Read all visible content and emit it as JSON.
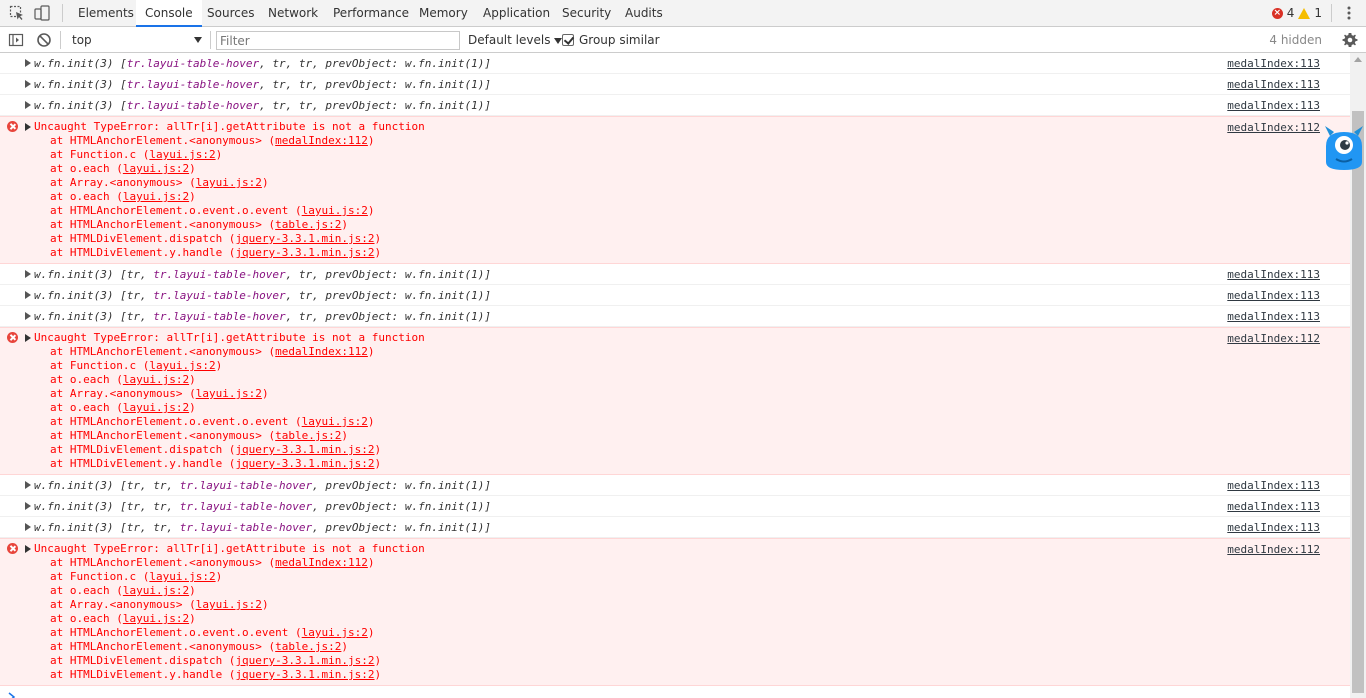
{
  "tabs": [
    {
      "label": "Elements"
    },
    {
      "label": "Console",
      "active": true
    },
    {
      "label": "Sources"
    },
    {
      "label": "Network"
    },
    {
      "label": "Performance"
    },
    {
      "label": "Memory"
    },
    {
      "label": "Application"
    },
    {
      "label": "Security"
    },
    {
      "label": "Audits"
    }
  ],
  "counts": {
    "errors": "4",
    "warnings": "1"
  },
  "toolbar": {
    "context": "top",
    "filter_placeholder": "Filter",
    "levels": "Default levels",
    "group_similar": "Group similar",
    "hidden": "4 hidden"
  },
  "colors": {
    "error_text": "#ff0000",
    "error_bg": "#fff0f0",
    "accent": "#1a73e8"
  },
  "log": [
    {
      "type": "obj",
      "parts": [
        "w.fn.init(3) [",
        "tr.layui-table-hover",
        ", tr, tr, prevObject: w.fn.init(1)]"
      ],
      "source": "medalIndex:113"
    },
    {
      "type": "obj",
      "parts": [
        "w.fn.init(3) [",
        "tr.layui-table-hover",
        ", tr, tr, prevObject: w.fn.init(1)]"
      ],
      "source": "medalIndex:113"
    },
    {
      "type": "obj",
      "parts": [
        "w.fn.init(3) [",
        "tr.layui-table-hover",
        ", tr, tr, prevObject: w.fn.init(1)]"
      ],
      "source": "medalIndex:113"
    },
    {
      "type": "err",
      "source": "medalIndex:112",
      "message": "Uncaught TypeError: allTr[i].getAttribute is not a function",
      "frames": [
        [
          "at HTMLAnchorElement.<anonymous> (",
          "medalIndex:112",
          ")"
        ],
        [
          "at Function.c (",
          "layui.js:2",
          ")"
        ],
        [
          "at o.each (",
          "layui.js:2",
          ")"
        ],
        [
          "at Array.<anonymous> (",
          "layui.js:2",
          ")"
        ],
        [
          "at o.each (",
          "layui.js:2",
          ")"
        ],
        [
          "at HTMLAnchorElement.o.event.o.event (",
          "layui.js:2",
          ")"
        ],
        [
          "at HTMLAnchorElement.<anonymous> (",
          "table.js:2",
          ")"
        ],
        [
          "at HTMLDivElement.dispatch (",
          "jquery-3.3.1.min.js:2",
          ")"
        ],
        [
          "at HTMLDivElement.y.handle (",
          "jquery-3.3.1.min.js:2",
          ")"
        ]
      ]
    },
    {
      "type": "obj",
      "parts": [
        "w.fn.init(3) [tr, ",
        "tr.layui-table-hover",
        ", tr, prevObject: w.fn.init(1)]"
      ],
      "source": "medalIndex:113"
    },
    {
      "type": "obj",
      "parts": [
        "w.fn.init(3) [tr, ",
        "tr.layui-table-hover",
        ", tr, prevObject: w.fn.init(1)]"
      ],
      "source": "medalIndex:113"
    },
    {
      "type": "obj",
      "parts": [
        "w.fn.init(3) [tr, ",
        "tr.layui-table-hover",
        ", tr, prevObject: w.fn.init(1)]"
      ],
      "source": "medalIndex:113"
    },
    {
      "type": "err",
      "source": "medalIndex:112",
      "message": "Uncaught TypeError: allTr[i].getAttribute is not a function",
      "frames": [
        [
          "at HTMLAnchorElement.<anonymous> (",
          "medalIndex:112",
          ")"
        ],
        [
          "at Function.c (",
          "layui.js:2",
          ")"
        ],
        [
          "at o.each (",
          "layui.js:2",
          ")"
        ],
        [
          "at Array.<anonymous> (",
          "layui.js:2",
          ")"
        ],
        [
          "at o.each (",
          "layui.js:2",
          ")"
        ],
        [
          "at HTMLAnchorElement.o.event.o.event (",
          "layui.js:2",
          ")"
        ],
        [
          "at HTMLAnchorElement.<anonymous> (",
          "table.js:2",
          ")"
        ],
        [
          "at HTMLDivElement.dispatch (",
          "jquery-3.3.1.min.js:2",
          ")"
        ],
        [
          "at HTMLDivElement.y.handle (",
          "jquery-3.3.1.min.js:2",
          ")"
        ]
      ]
    },
    {
      "type": "obj",
      "parts": [
        "w.fn.init(3) [tr, tr, ",
        "tr.layui-table-hover",
        ", prevObject: w.fn.init(1)]"
      ],
      "source": "medalIndex:113"
    },
    {
      "type": "obj",
      "parts": [
        "w.fn.init(3) [tr, tr, ",
        "tr.layui-table-hover",
        ", prevObject: w.fn.init(1)]"
      ],
      "source": "medalIndex:113"
    },
    {
      "type": "obj",
      "parts": [
        "w.fn.init(3) [tr, tr, ",
        "tr.layui-table-hover",
        ", prevObject: w.fn.init(1)]"
      ],
      "source": "medalIndex:113"
    },
    {
      "type": "err",
      "source": "medalIndex:112",
      "message": "Uncaught TypeError: allTr[i].getAttribute is not a function",
      "frames": [
        [
          "at HTMLAnchorElement.<anonymous> (",
          "medalIndex:112",
          ")"
        ],
        [
          "at Function.c (",
          "layui.js:2",
          ")"
        ],
        [
          "at o.each (",
          "layui.js:2",
          ")"
        ],
        [
          "at Array.<anonymous> (",
          "layui.js:2",
          ")"
        ],
        [
          "at o.each (",
          "layui.js:2",
          ")"
        ],
        [
          "at HTMLAnchorElement.o.event.o.event (",
          "layui.js:2",
          ")"
        ],
        [
          "at HTMLAnchorElement.<anonymous> (",
          "table.js:2",
          ")"
        ],
        [
          "at HTMLDivElement.dispatch (",
          "jquery-3.3.1.min.js:2",
          ")"
        ],
        [
          "at HTMLDivElement.y.handle (",
          "jquery-3.3.1.min.js:2",
          ")"
        ]
      ]
    }
  ],
  "icons": {
    "inspect": "inspect-element-icon",
    "device": "device-toolbar-icon",
    "sidebar": "console-sidebar-icon",
    "clear": "clear-console-icon",
    "settings": "gear-icon",
    "menu": "kebab-menu-icon",
    "prompt": "console-prompt-icon",
    "mascot": "monster-mascot-icon"
  }
}
